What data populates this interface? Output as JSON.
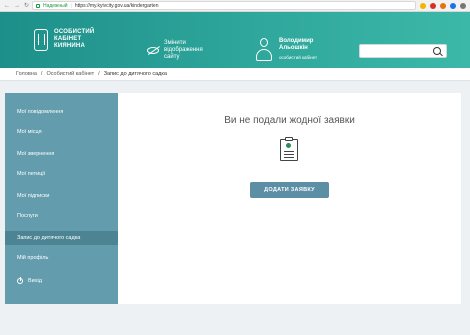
{
  "browser": {
    "security_label": "Надежный",
    "url": "https://my.kyivcity.gov.ua/kindergarten"
  },
  "header": {
    "brand_lines": [
      "ОСОБИСТИЙ",
      "КАБІНЕТ",
      "КИЯНИНА"
    ],
    "accessibility_lines": [
      "Змінити",
      "відображення",
      "сайту"
    ],
    "user_name_lines": [
      "Володимир",
      "Альошкін"
    ],
    "user_role": "особистий кабінет",
    "search_placeholder": ""
  },
  "breadcrumb": {
    "items": [
      "Головна",
      "Особистий кабінет",
      "Запис до дитячого садка"
    ],
    "separator": "/"
  },
  "sidebar": {
    "items": [
      {
        "label": "Мої повідомлення"
      },
      {
        "label": "Мої місця"
      },
      {
        "label": "Мої звернення"
      },
      {
        "label": "Мої петиції"
      },
      {
        "label": "Мої підписки"
      },
      {
        "label": "Послуги"
      },
      {
        "label": "Запис до дитячого садка",
        "active": true
      },
      {
        "label": "Мій профіль"
      },
      {
        "label": "Вихід"
      }
    ]
  },
  "main": {
    "empty_title": "Ви не подали жодної заявки",
    "add_button": "ДОДАТИ ЗАЯВКУ"
  },
  "colors": {
    "header_start": "#1d8f8a",
    "header_end": "#3cb8a8",
    "sidebar": "#639cad",
    "sidebar_active": "#4d8494",
    "button": "#5c8fa6"
  },
  "icons": [
    "lock-icon",
    "kyiv-logo-icon",
    "eye-slash-icon",
    "user-avatar-icon",
    "search-icon",
    "clipboard-icon",
    "logout-icon"
  ]
}
